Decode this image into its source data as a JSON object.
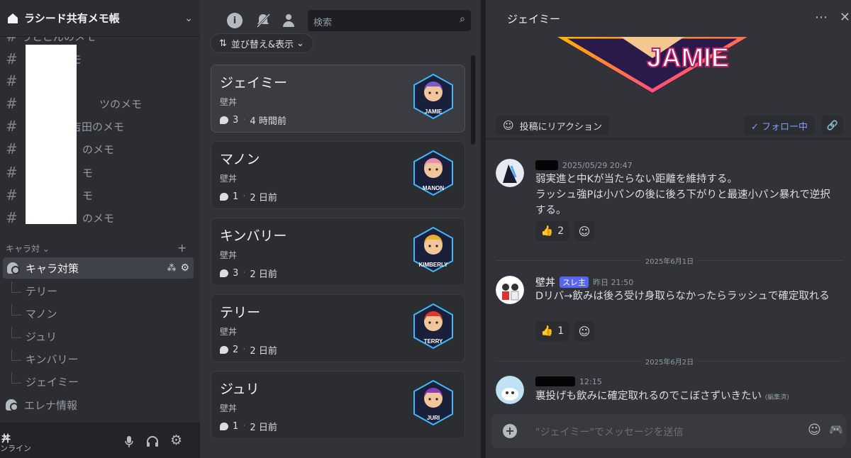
{
  "server": {
    "name": "ラシード共有メモ帳"
  },
  "sidebar": {
    "channels": [
      {
        "label": "うとこんのメモ"
      },
      {
        "label": "モ"
      },
      {
        "label": ""
      },
      {
        "label": "ツのメモ"
      },
      {
        "label": "吉田のメモ"
      },
      {
        "label": "のメモ"
      },
      {
        "label": "モ"
      },
      {
        "label": "モ"
      },
      {
        "label": "のメモ"
      }
    ],
    "category": "キャラ対",
    "forum": "キャラ対策",
    "threads": [
      "テリー",
      "マノン",
      "ジュリ",
      "キンバリー",
      "ジェイミー"
    ],
    "forum2": "エレナ情報",
    "user": {
      "name": "丼",
      "status": "ンライン"
    }
  },
  "forum": {
    "search_placeholder": "検索",
    "sort_label": "並び替え&表示",
    "posts": [
      {
        "title": "ジェイミー",
        "author": "壁丼",
        "count": "3",
        "time": "4 時間前",
        "badge": "JAMIE",
        "color": "#7c5cc4"
      },
      {
        "title": "マノン",
        "author": "壁丼",
        "count": "1",
        "time": "2 日前",
        "badge": "MANON",
        "color": "#e88fb0"
      },
      {
        "title": "キンバリー",
        "author": "壁丼",
        "count": "3",
        "time": "2 日前",
        "badge": "KIMBERLY",
        "color": "#e6b22e"
      },
      {
        "title": "テリー",
        "author": "壁丼",
        "count": "2",
        "time": "2 日前",
        "badge": "TERRY",
        "color": "#d83a2e"
      },
      {
        "title": "ジュリ",
        "author": "壁丼",
        "count": "1",
        "time": "2 日前",
        "badge": "JURI",
        "color": "#8a3fb8"
      }
    ]
  },
  "thread": {
    "title": "ジェイミー",
    "banner_text": "JAMIE",
    "react_label": "投稿にリアクション",
    "follow_label": "✓ フォロー中",
    "messages": [
      {
        "author": "",
        "time": "2025/05/29 20:47",
        "lines": [
          "弱実進と中Kが当たらない距離を維持する。",
          "ラッシュ強Pは小パンの後に後ろ下がりと最速小パン暴れで逆択する。"
        ],
        "reaction": "2"
      },
      {
        "author": "壁丼",
        "badge": "スレ主",
        "time": "昨日 21:50",
        "lines": [
          "Dリバ→飲みは後ろ受け身取らなかったらラッシュで確定取れる"
        ],
        "reaction": "1"
      },
      {
        "author": "",
        "time": "12:15",
        "lines": [
          "裏投げも飲みに確定取れるのでこぼさずいきたい"
        ],
        "edited": "(編集済)"
      }
    ],
    "dividers": [
      "2025年6月1日",
      "2025年6月2日"
    ],
    "input_placeholder": "\"ジェイミー\"でメッセージを送信"
  }
}
